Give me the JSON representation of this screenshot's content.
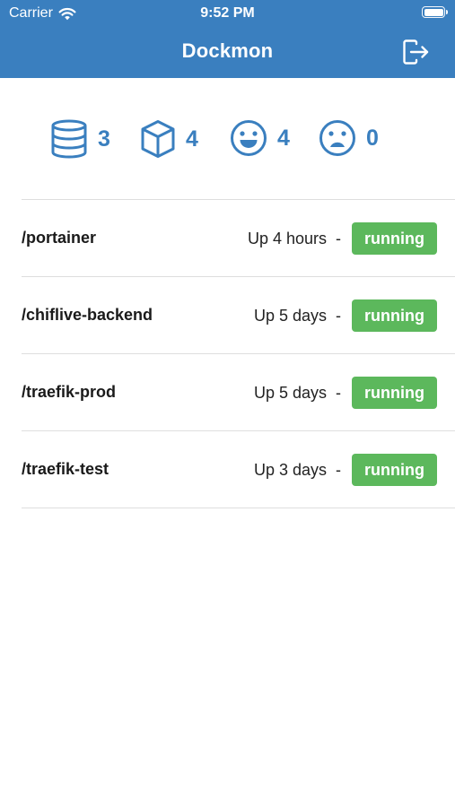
{
  "status_bar": {
    "carrier": "Carrier",
    "time": "9:52 PM"
  },
  "nav": {
    "title": "Dockmon",
    "logout_icon": "logout-icon"
  },
  "stats": {
    "images": {
      "icon": "database-icon",
      "value": "3"
    },
    "containers": {
      "icon": "cube-icon",
      "value": "4"
    },
    "healthy": {
      "icon": "smile-icon",
      "value": "4"
    },
    "unhealthy": {
      "icon": "frown-icon",
      "value": "0"
    }
  },
  "containers": [
    {
      "name": "/portainer",
      "uptime": "Up 4 hours",
      "separator": "-",
      "status": "running"
    },
    {
      "name": "/chiflive-backend",
      "uptime": "Up 5 days",
      "separator": "-",
      "status": "running"
    },
    {
      "name": "/traefik-prod",
      "uptime": "Up 5 days",
      "separator": "-",
      "status": "running"
    },
    {
      "name": "/traefik-test",
      "uptime": "Up 3 days",
      "separator": "-",
      "status": "running"
    }
  ],
  "colors": {
    "primary": "#3a7fbf",
    "running": "#5cb85c",
    "divider": "#dedede"
  }
}
